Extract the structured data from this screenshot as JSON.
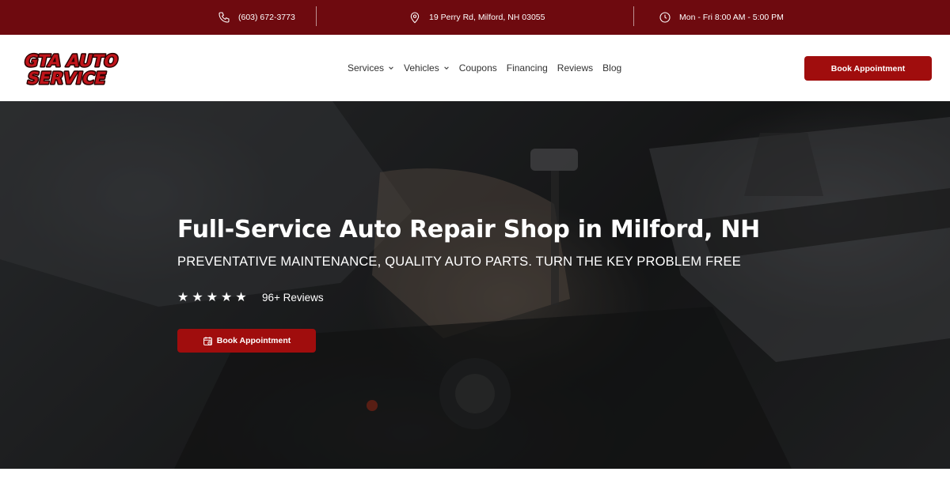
{
  "topbar": {
    "phone": "(603) 672-3773",
    "address": "19 Perry Rd, Milford, NH 03055",
    "hours": "Mon - Fri 8:00 AM - 5:00 PM",
    "phone_icon": "phone-icon",
    "address_icon": "map-pin-icon",
    "hours_icon": "clock-icon"
  },
  "brand": {
    "logo_line1": "GTA AUTO",
    "logo_line2": "SERVICE",
    "primary_color": "#a00d0d",
    "topbar_color": "#6e0a0f"
  },
  "nav": {
    "items": [
      {
        "label": "Services",
        "has_dropdown": true
      },
      {
        "label": "Vehicles",
        "has_dropdown": true
      },
      {
        "label": "Coupons",
        "has_dropdown": false
      },
      {
        "label": "Financing",
        "has_dropdown": false
      },
      {
        "label": "Reviews",
        "has_dropdown": false
      },
      {
        "label": "Blog",
        "has_dropdown": false
      }
    ],
    "cta_label": "Book Appointment"
  },
  "hero": {
    "title": "Full-Service Auto Repair Shop in Milford, NH",
    "subtitle": "PREVENTATIVE MAINTENANCE, QUALITY AUTO PARTS. TURN THE KEY PROBLEM FREE",
    "rating_stars": 5,
    "reviews_label": "96+ Reviews",
    "cta_label": "Book Appointment",
    "cta_icon": "calendar-icon"
  }
}
